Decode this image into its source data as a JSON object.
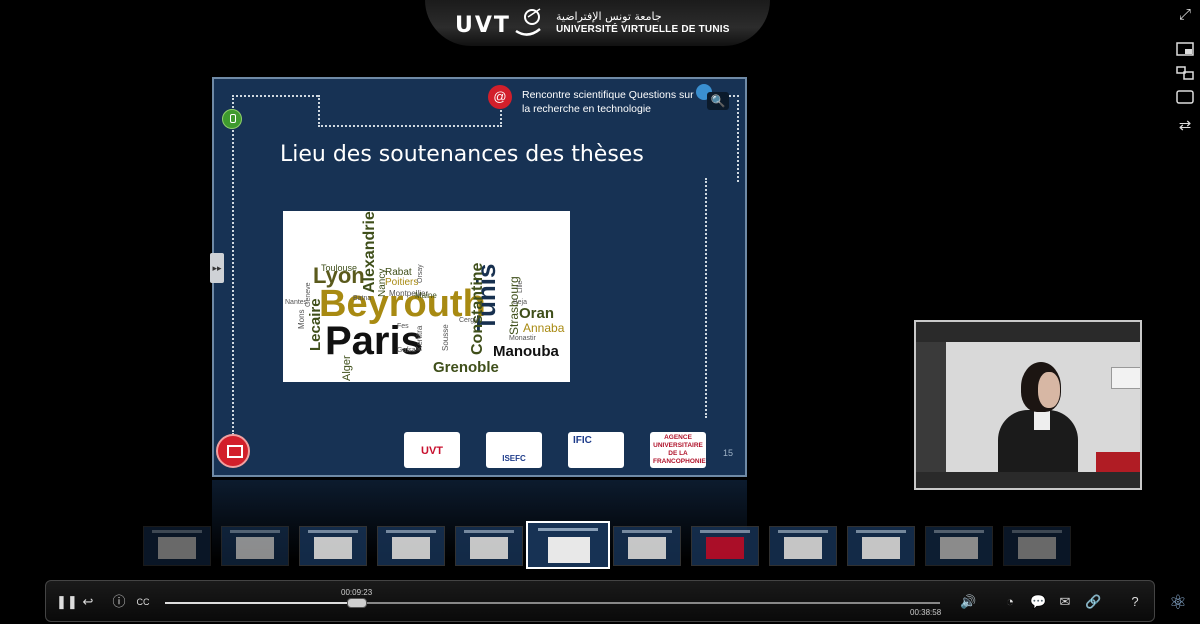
{
  "header": {
    "logo_short": "UVT",
    "arabic_name": "جامعة تونس الإفتراضية",
    "french_name": "UNIVERSITÉ VIRTUELLE DE TUNIS"
  },
  "slide": {
    "header_text": "Rencontre scientifique Questions sur la recherche en technologie",
    "title": "Lieu des soutenances des thèses",
    "page_number": "15",
    "wordcloud": [
      "Beyrouth",
      "Paris",
      "Tunis",
      "Constantine",
      "Lyon",
      "Alexandrie",
      "Lecaire",
      "Manouba",
      "Grenoble",
      "Oran",
      "Annaba",
      "Strasbourg",
      "Toulouse",
      "Rabat",
      "Poitiers",
      "Alger",
      "Nancy",
      "Montpellier",
      "Maine",
      "Mons",
      "Batna",
      "Kenitra",
      "Sousse",
      "Cergy",
      "Fes",
      "Nantes",
      "Monastir",
      "Orsay",
      "Lille",
      "Geneve",
      "Gafsa",
      "Beja"
    ],
    "partner_logos": [
      "UVT",
      "ISEFC",
      "IFIC",
      "AGENCE UNIVERSITAIRE DE LA FRANCOPHONIE"
    ]
  },
  "player": {
    "current_time": "00:09:23",
    "total_time": "00:38:58",
    "progress": 0.246
  },
  "icons": {
    "right_toolbar": [
      "fullscreen-icon",
      "layout-pip-icon",
      "layout-swap-icon",
      "layout-single-icon",
      "sync-icon"
    ],
    "controls": [
      "pause-icon",
      "back-icon",
      "info-icon",
      "cc-icon",
      "volume-icon",
      "chapters-icon",
      "comment-icon",
      "email-icon",
      "link-icon",
      "help-icon",
      "atom-icon"
    ]
  },
  "colors": {
    "slide_bg": "#173254",
    "accent_red": "#d21f2b",
    "accent_green": "#3e9a2e"
  }
}
